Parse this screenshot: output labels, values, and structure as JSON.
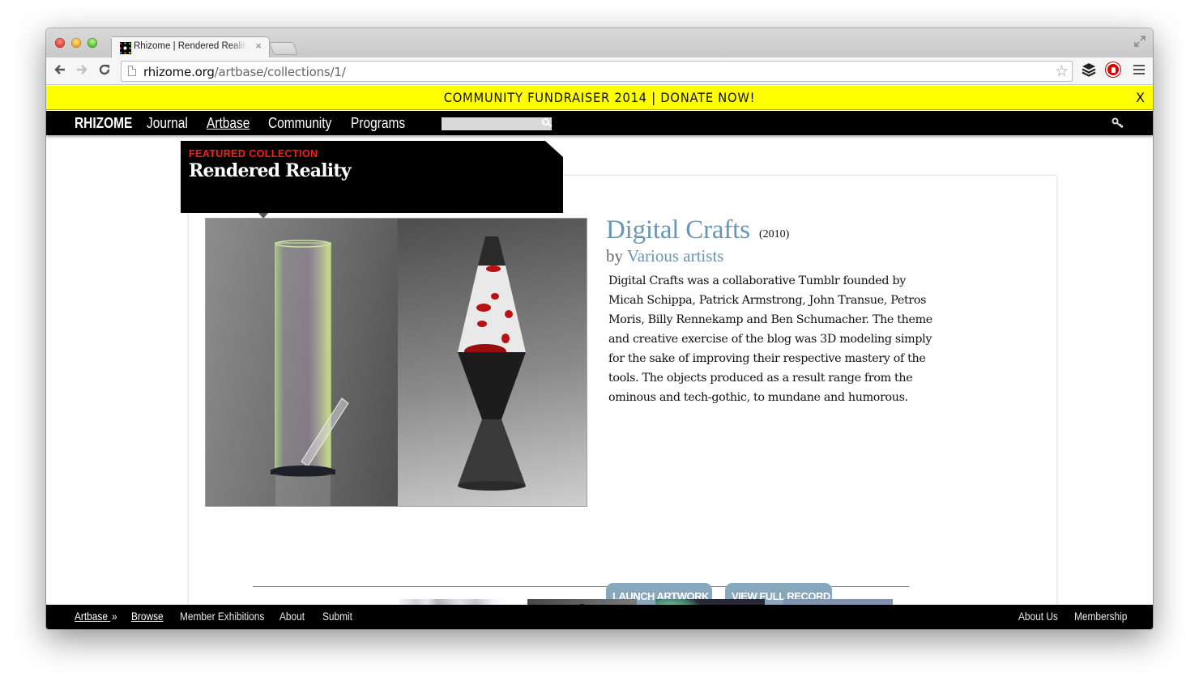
{
  "browser": {
    "tab": {
      "title": "Rhizome | Rendered Reality",
      "close_glyph": "×"
    },
    "toolbar": {
      "back_glyph": "←",
      "forward_glyph": "→",
      "reload_glyph": "C",
      "url_host": "rhizome.org",
      "url_path": "/artbase/collections/1/",
      "star_glyph": "☆"
    },
    "fullscreen_glyph": "⤢",
    "extensions": [
      "buffer-icon",
      "adblock-icon"
    ]
  },
  "banner": {
    "text": "COMMUNITY FUNDRAISER 2014 | DONATE NOW!",
    "close_label": "X",
    "background": "#ffff00"
  },
  "nav": {
    "logo": "RHIZOME",
    "items": [
      {
        "label": "Journal",
        "active": false
      },
      {
        "label": "Artbase",
        "active": true
      },
      {
        "label": "Community",
        "active": false
      },
      {
        "label": "Programs",
        "active": false
      }
    ],
    "search": {
      "value": "",
      "placeholder": ""
    },
    "login_icon": "key-icon"
  },
  "featured": {
    "kicker": "FEATURED COLLECTION",
    "collection_title": "Rendered Reality",
    "kicker_color": "#ff1a1a"
  },
  "artwork": {
    "title": "Digital Crafts",
    "year": "(2010)",
    "by_prefix": "by",
    "artist": "Various artists",
    "description": "Digital Crafts was a collaborative Tumblr founded by Micah Schippa, Patrick Armstrong, John Transue, Petros Moris, Billy Rennekamp and Ben Schumacher. The theme and creative exercise of the blog was 3D modeling simply for the sake of improving their respective mastery of the tools. The objects produced as a result range from the ominous and tech-gothic, to mundane and humorous.",
    "image_alt": "Rendered glass tube and lava lamp",
    "link_color": "#6a95b3",
    "actions": {
      "launch": "LAUNCH ARTWORK",
      "record": "VIEW FULL RECORD"
    }
  },
  "thumbnails": [
    {
      "name": "thumbnail-portrait"
    },
    {
      "name": "thumbnail-curtains"
    },
    {
      "name": "thumbnail-lava-lamp"
    },
    {
      "name": "thumbnail-green-splash"
    },
    {
      "name": "thumbnail-blue-sky"
    }
  ],
  "subnav": {
    "left": [
      {
        "label": "Artbase",
        "suffix": "»"
      },
      {
        "label": "Browse"
      },
      {
        "label": "Member Exhibitions"
      },
      {
        "label": "About"
      },
      {
        "label": "Submit"
      }
    ],
    "right": [
      {
        "label": "About Us"
      },
      {
        "label": "Membership"
      }
    ]
  }
}
